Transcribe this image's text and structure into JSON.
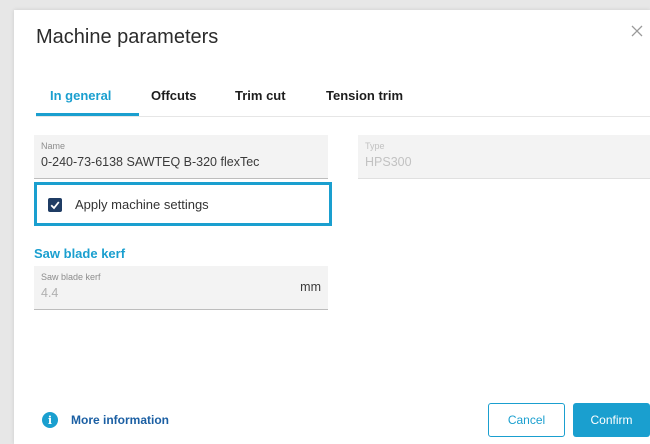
{
  "dialog": {
    "title": "Machine parameters",
    "close_icon": "close-icon"
  },
  "tabs": [
    {
      "label": "In general",
      "active": true
    },
    {
      "label": "Offcuts",
      "active": false
    },
    {
      "label": "Trim cut",
      "active": false
    },
    {
      "label": "Tension trim",
      "active": false
    }
  ],
  "fields": {
    "name": {
      "label": "Name",
      "value": "0-240-73-6138 SAWTEQ B-320 flexTec"
    },
    "type": {
      "label": "Type",
      "value": "HPS300",
      "disabled": true
    }
  },
  "apply_settings": {
    "label": "Apply machine settings",
    "checked": true
  },
  "saw_blade": {
    "heading": "Saw blade kerf",
    "field_label": "Saw blade kerf",
    "value": "4.4",
    "unit": "mm"
  },
  "footer": {
    "more_info": "More information",
    "cancel": "Cancel",
    "confirm": "Confirm"
  },
  "colors": {
    "accent": "#1a9fcf",
    "checkbox": "#1f3c64",
    "link": "#1b5fa3"
  }
}
